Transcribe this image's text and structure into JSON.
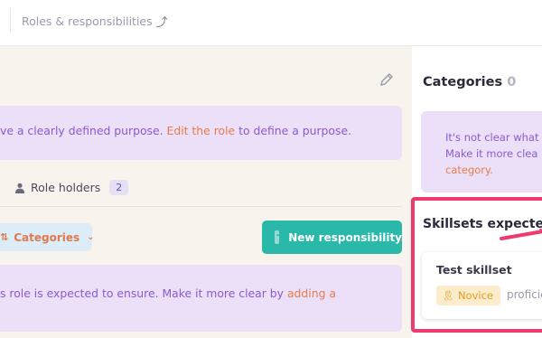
{
  "header": {
    "breadcrumb_label": "Roles & responsibilities",
    "sort_icon": "sort-icon"
  },
  "role": {
    "edit_icon": "pencil-icon",
    "purpose_text_before": "ve a clearly defined purpose. ",
    "purpose_link": "Edit the role",
    "purpose_text_after": " to define a purpose.",
    "role_holders_label": "Role holders",
    "role_holders_count": "2"
  },
  "responsibilities": {
    "filter_label": "Categories",
    "new_button_label": "New responsibility",
    "empty_text_before": "s role is expected to ensure. Make it more clear by ",
    "empty_link": "adding a"
  },
  "sidebar": {
    "categories_title": "Categories",
    "categories_count": "0",
    "categories_empty_line1": "It's not clear what",
    "categories_empty_line2": "Make it more clea",
    "categories_empty_link": "category.",
    "skillsets_title": "Skillsets expected",
    "skill_name": "Test skillset",
    "skill_level": "Novice",
    "skill_prof_text": "proficie"
  },
  "colors": {
    "accent_teal": "#2ab8a8",
    "highlight_pink": "#ee3a6e",
    "link_orange": "#e87b4c",
    "purple_text": "#8a5ad0"
  }
}
